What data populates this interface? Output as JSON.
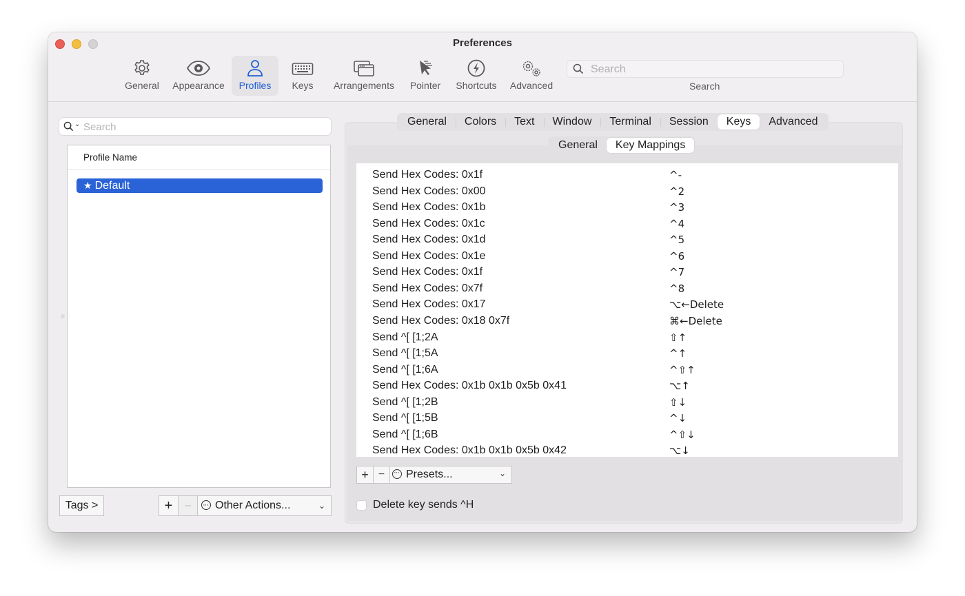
{
  "window": {
    "title": "Preferences"
  },
  "toolbar": {
    "items": [
      {
        "label": "General",
        "icon": "gear-icon"
      },
      {
        "label": "Appearance",
        "icon": "eye-icon"
      },
      {
        "label": "Profiles",
        "icon": "person-icon",
        "active": true
      },
      {
        "label": "Keys",
        "icon": "keyboard-icon"
      },
      {
        "label": "Arrangements",
        "icon": "windows-icon"
      },
      {
        "label": "Pointer",
        "icon": "pointer-icon"
      },
      {
        "label": "Shortcuts",
        "icon": "bolt-icon"
      },
      {
        "label": "Advanced",
        "icon": "gears-icon"
      }
    ],
    "search_placeholder": "Search",
    "search_label": "Search"
  },
  "profiles": {
    "search_placeholder": "Search",
    "column_header": "Profile Name",
    "items": [
      {
        "name": "Default",
        "is_default": true,
        "selected": true
      }
    ],
    "tags_button": "Tags >",
    "add_button": "+",
    "remove_button": "−",
    "other_actions": "Other Actions..."
  },
  "profile_tabs": {
    "items": [
      "General",
      "Colors",
      "Text",
      "Window",
      "Terminal",
      "Session",
      "Keys",
      "Advanced"
    ],
    "active": "Keys"
  },
  "keys_subtabs": {
    "items": [
      "General",
      "Key Mappings"
    ],
    "active": "Key Mappings"
  },
  "key_mappings": [
    {
      "action": "Send Hex Codes: 0x1f",
      "key": "^-"
    },
    {
      "action": "Send Hex Codes: 0x00",
      "key": "^2"
    },
    {
      "action": "Send Hex Codes: 0x1b",
      "key": "^3"
    },
    {
      "action": "Send Hex Codes: 0x1c",
      "key": "^4"
    },
    {
      "action": "Send Hex Codes: 0x1d",
      "key": "^5"
    },
    {
      "action": "Send Hex Codes: 0x1e",
      "key": "^6"
    },
    {
      "action": "Send Hex Codes: 0x1f",
      "key": "^7"
    },
    {
      "action": "Send Hex Codes: 0x7f",
      "key": "^8"
    },
    {
      "action": "Send Hex Codes: 0x17",
      "key": "⌥←Delete"
    },
    {
      "action": "Send Hex Codes: 0x18 0x7f",
      "key": "⌘←Delete"
    },
    {
      "action": "Send ^[ [1;2A",
      "key": "⇧↑"
    },
    {
      "action": "Send ^[ [1;5A",
      "key": "^↑"
    },
    {
      "action": "Send ^[ [1;6A",
      "key": "^⇧↑"
    },
    {
      "action": "Send Hex Codes: 0x1b 0x1b 0x5b 0x41",
      "key": "⌥↑"
    },
    {
      "action": "Send ^[ [1;2B",
      "key": "⇧↓"
    },
    {
      "action": "Send ^[ [1;5B",
      "key": "^↓"
    },
    {
      "action": "Send ^[ [1;6B",
      "key": "^⇧↓"
    },
    {
      "action": "Send Hex Codes: 0x1b 0x1b 0x5b 0x42",
      "key": "⌥↓"
    }
  ],
  "mapping_controls": {
    "add_button": "+",
    "remove_button": "−",
    "presets": "Presets..."
  },
  "delete_key_option": {
    "label": "Delete key sends ^H",
    "checked": false
  }
}
